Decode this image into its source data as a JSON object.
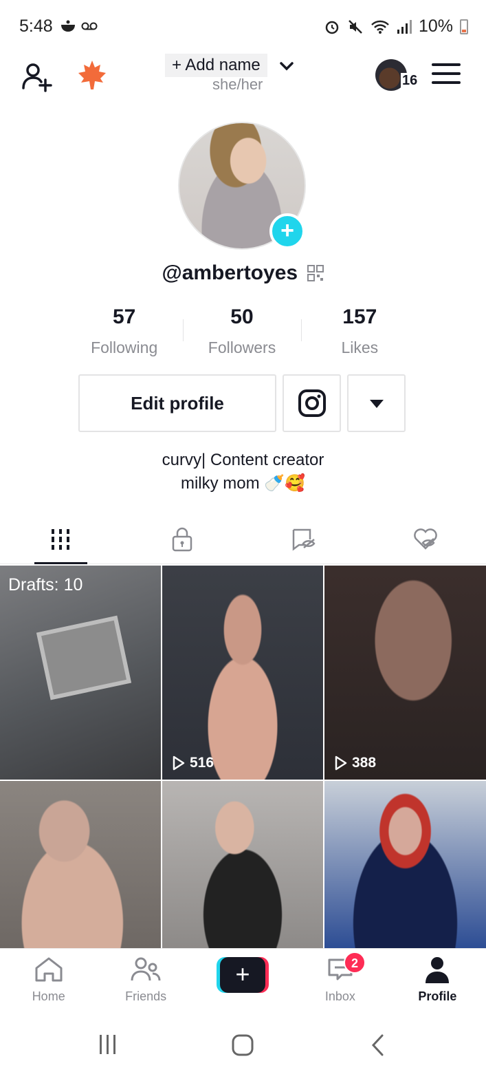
{
  "status_bar": {
    "time": "5:48",
    "battery": "10%"
  },
  "header": {
    "add_name": "+ Add name",
    "pronouns": "she/her",
    "account_count": "16"
  },
  "profile": {
    "username": "@ambertoyes",
    "stats": [
      {
        "value": "57",
        "label": "Following"
      },
      {
        "value": "50",
        "label": "Followers"
      },
      {
        "value": "157",
        "label": "Likes"
      }
    ],
    "edit_label": "Edit profile",
    "bio_line1": "curvy| Content creator",
    "bio_line2": "milky mom 🍼🥰"
  },
  "grid": {
    "drafts": "Drafts: 10",
    "tiles": [
      {
        "views": ""
      },
      {
        "views": "516"
      },
      {
        "views": "388"
      },
      {
        "views": ""
      },
      {
        "views": ""
      },
      {
        "views": ""
      }
    ]
  },
  "nav": {
    "home": "Home",
    "friends": "Friends",
    "inbox": "Inbox",
    "inbox_badge": "2",
    "profile": "Profile"
  },
  "colors": {
    "accent_cyan": "#20d5ec",
    "accent_red": "#fe2c55",
    "text": "#161823",
    "muted": "#8a8b91"
  }
}
